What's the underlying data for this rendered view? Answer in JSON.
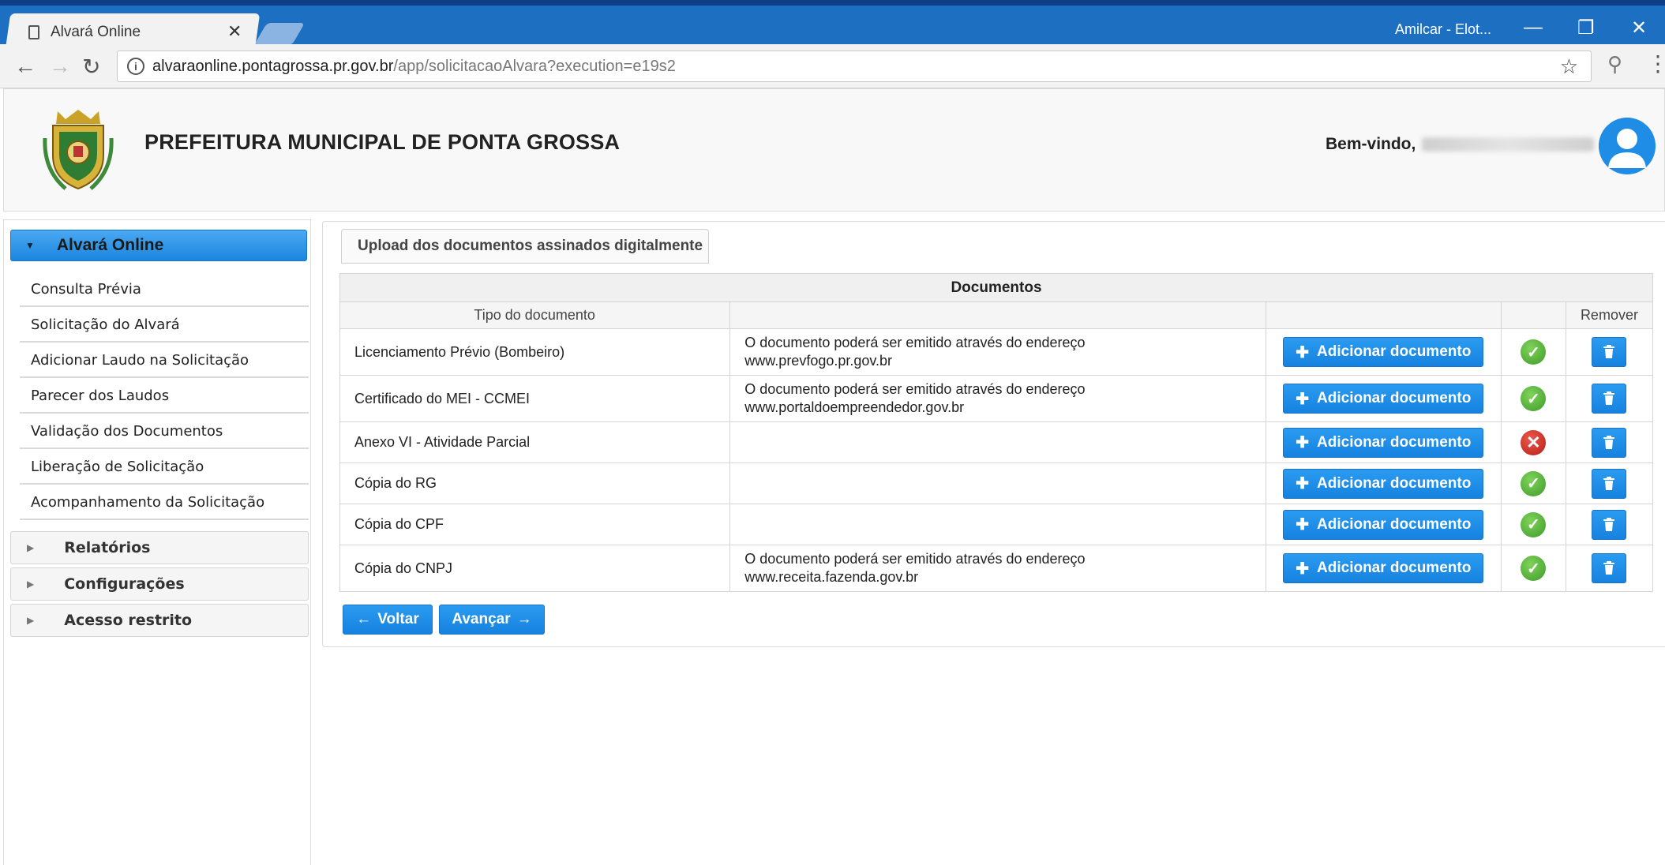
{
  "browser": {
    "tab_title": "Alvará Online",
    "user_label": "Amilcar - Elot...",
    "url_host": "alvaraonline.pontagrossa.pr.gov.br",
    "url_path": "/app/solicitacaoAlvara?execution=e19s2"
  },
  "header": {
    "title": "PREFEITURA MUNICIPAL DE PONTA GROSSA",
    "welcome": "Bem-vindo,"
  },
  "sidebar": {
    "active_menu": "Alvará Online",
    "items": [
      {
        "label": "Consulta Prévia"
      },
      {
        "label": "Solicitação do Alvará"
      },
      {
        "label": "Adicionar Laudo na Solicitação"
      },
      {
        "label": "Parecer dos Laudos"
      },
      {
        "label": "Validação dos Documentos"
      },
      {
        "label": "Liberação de Solicitação"
      },
      {
        "label": "Acompanhamento da Solicitação"
      }
    ],
    "menus": [
      {
        "label": "Relatórios"
      },
      {
        "label": "Configurações"
      },
      {
        "label": "Acesso restrito"
      }
    ]
  },
  "main": {
    "tab": "Upload dos documentos assinados digitalmente",
    "table_caption": "Documentos",
    "columns": {
      "type": "Tipo do documento",
      "remove": "Remover"
    },
    "add_label": "Adicionar documento",
    "rows": [
      {
        "type": "Licenciamento Prévio (Bombeiro)",
        "desc1": "O documento poderá ser emitido através do endereço",
        "desc2": "www.prevfogo.pr.gov.br",
        "status": "ok"
      },
      {
        "type": "Certificado do MEI - CCMEI",
        "desc1": "O documento poderá ser emitido através do endereço",
        "desc2": "www.portaldoempreendedor.gov.br",
        "status": "ok"
      },
      {
        "type": "Anexo VI - Atividade Parcial",
        "desc1": "",
        "desc2": "",
        "status": "error"
      },
      {
        "type": "Cópia do RG",
        "desc1": "",
        "desc2": "",
        "status": "ok"
      },
      {
        "type": "Cópia do CPF",
        "desc1": "",
        "desc2": "",
        "status": "ok"
      },
      {
        "type": "Cópia do CNPJ",
        "desc1": "O documento poderá ser emitido através do endereço",
        "desc2": "www.receita.fazenda.gov.br",
        "status": "ok"
      }
    ],
    "back_label": "Voltar",
    "next_label": "Avançar"
  }
}
